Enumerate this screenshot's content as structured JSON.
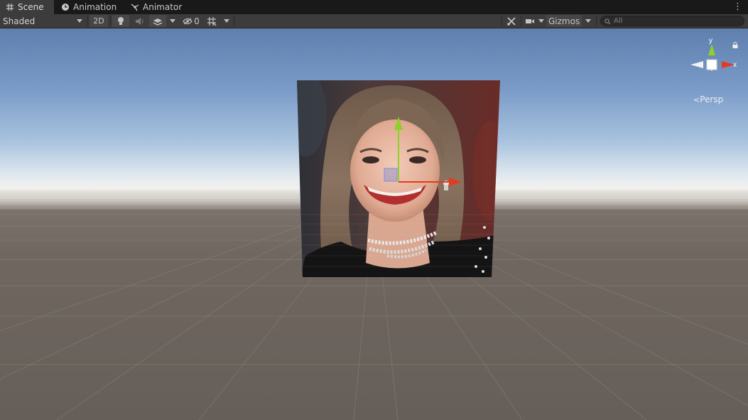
{
  "tabs": [
    {
      "label": "Scene",
      "icon": "grid-hash-icon",
      "active": true
    },
    {
      "label": "Animation",
      "icon": "clock-icon",
      "active": false
    },
    {
      "label": "Animator",
      "icon": "animator-graph-icon",
      "active": false
    }
  ],
  "menu": {
    "icon": "kebab-menu-icon"
  },
  "toolbar": {
    "draw_mode": "Shaded",
    "toggle_2d": "2D",
    "lighting_icon": "lightbulb-icon",
    "audio_icon": "speaker-icon",
    "effects_icon": "effects-layers-icon",
    "hidden_count": "0",
    "hidden_icon": "eye-slash-icon",
    "grid_icon": "grid-snap-icon",
    "tools_icon": "tools-wrench-icon",
    "camera_icon": "camera-icon",
    "gizmos_label": "Gizmos",
    "search_placeholder": "All"
  },
  "orientation_gizmo": {
    "y_label": "y",
    "x_label": "x",
    "projection": "Persp",
    "lock_icon": "lock-icon"
  },
  "colors": {
    "x_axis": "#e23b22",
    "y_axis": "#8fd02a",
    "z_axis": "#3b6bd8",
    "panel": "#3c3c3c",
    "tab_bar": "#191919"
  }
}
